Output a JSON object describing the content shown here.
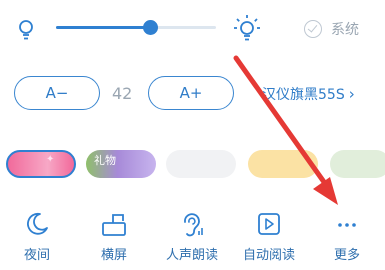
{
  "brightness": {
    "level": 0.59,
    "system_label": "系统",
    "system_checked": false
  },
  "font": {
    "decrease_label": "A−",
    "increase_label": "A+",
    "size_value": "42",
    "font_name": "汉仪旗黑55S"
  },
  "themes": {
    "gift_label": "礼物",
    "selected": "pink"
  },
  "toolbar": {
    "items": [
      {
        "label": "夜间",
        "icon": "moon-icon"
      },
      {
        "label": "横屏",
        "icon": "landscape-icon"
      },
      {
        "label": "人声朗读",
        "icon": "ear-icon"
      },
      {
        "label": "自动阅读",
        "icon": "autoplay-icon"
      },
      {
        "label": "更多",
        "icon": "more-dots-icon"
      }
    ]
  },
  "colors": {
    "accent": "#2f80d1",
    "annotation_arrow": "#e53935"
  }
}
